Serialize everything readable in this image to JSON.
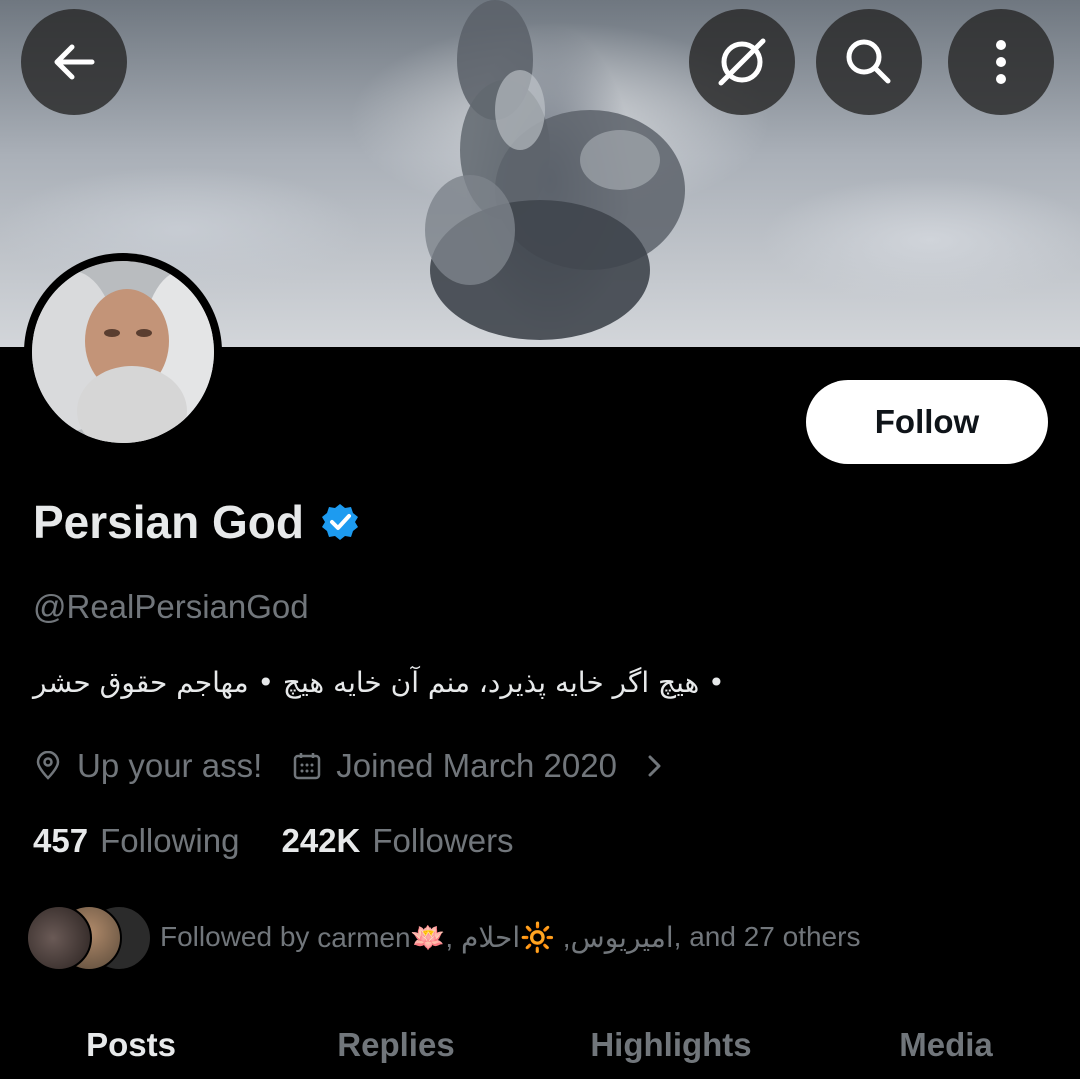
{
  "header": {
    "back_icon": "arrow-left-icon",
    "grok_icon": "grok-icon",
    "search_icon": "search-icon",
    "more_icon": "more-vertical-icon"
  },
  "profile": {
    "display_name": "Persian God",
    "verified": true,
    "verified_color": "#1d9bf0",
    "handle": "@RealPersianGod",
    "bio": "• هیچ اگر خایه پذیرد، منم آن خایه هیچ • مهاجم حقوق حشر",
    "location": "Up your ass!",
    "joined": "Joined March 2020",
    "follow_label": "Follow"
  },
  "stats": {
    "following_count": "457",
    "following_label": "Following",
    "followers_count": "242K",
    "followers_label": "Followers"
  },
  "followed_by": {
    "prefix": "Followed by ",
    "names": "carmen🪷, امیریوس, 🔆احلام",
    "suffix": ", and 27 others"
  },
  "tabs": [
    "Posts",
    "Replies",
    "Highlights",
    "Media"
  ],
  "active_tab": "Posts"
}
